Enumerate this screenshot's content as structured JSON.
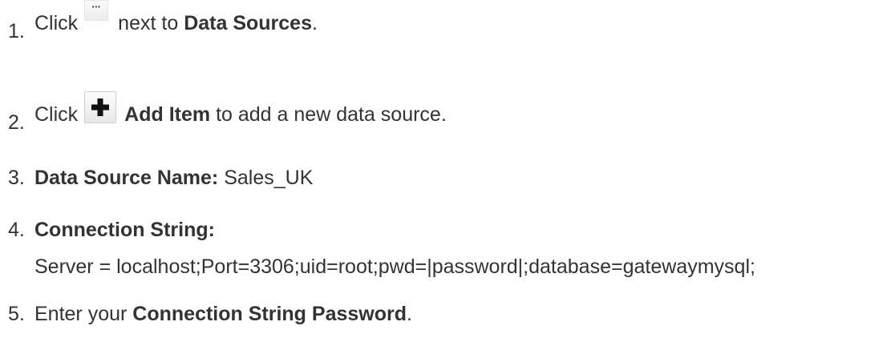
{
  "steps": [
    {
      "num": "1.",
      "pre": "Click",
      "mid": "next to",
      "bold": "Data Sources",
      "post": "."
    },
    {
      "num": "2.",
      "pre": "Click",
      "bold": "Add Item",
      "post": "to add a new data source."
    },
    {
      "num": "3.",
      "bold": "Data Source Name:",
      "post": "Sales_UK"
    },
    {
      "num": "4.",
      "bold": "Connection String:",
      "detail": "Server = localhost;Port=3306;uid=root;pwd=|password|;database=gatewaymysql;"
    },
    {
      "num": "5.",
      "pre": "Enter your",
      "bold": "Connection String Password",
      "post": "."
    }
  ],
  "icons": {
    "step1": "ellipsis-icon",
    "step2": "plus-icon"
  }
}
